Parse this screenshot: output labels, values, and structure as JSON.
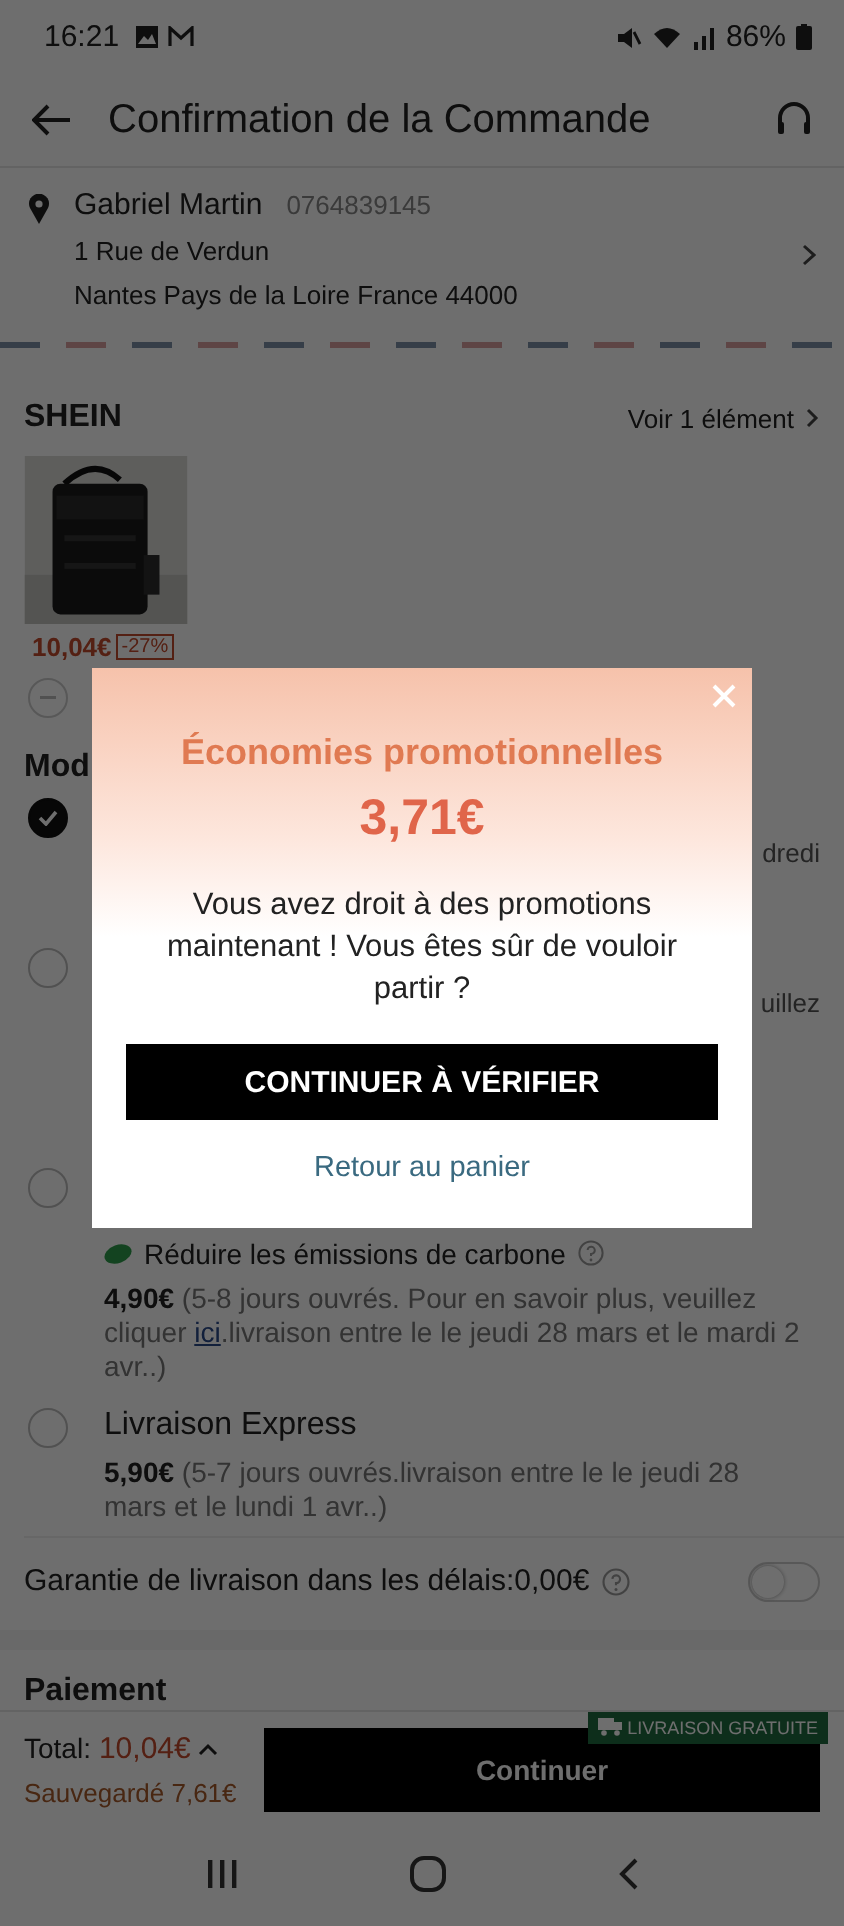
{
  "status_bar": {
    "time": "16:21",
    "battery": "86%"
  },
  "header": {
    "title": "Confirmation de la Commande"
  },
  "address": {
    "name": "Gabriel Martin",
    "phone": "0764839145",
    "line1": "1 Rue de Verdun",
    "line2": "Nantes Pays de la Loire France 44000"
  },
  "store": {
    "name": "SHEIN",
    "link": "Voir 1 élément"
  },
  "product": {
    "kind": "picture",
    "price": "10,04€",
    "discount": "-27%"
  },
  "shipping": {
    "title": "Mod",
    "options": [
      {
        "kind": "fragment",
        "selected": true,
        "fragment": "dredi"
      },
      {
        "kind": "fragment",
        "selected": false,
        "fragment": "uillez"
      },
      {
        "kind": "eco",
        "selected": false,
        "eco": "Réduire les émissions de carbone",
        "price": "4,90€",
        "details_before": "(5-8 jours ouvrés. Pour en savoir plus, veuillez cliquer ",
        "link": "ici",
        "details_after": ".livraison entre le le jeudi 28 mars et le mardi 2 avr..)"
      },
      {
        "kind": "standard",
        "selected": false,
        "name": "Livraison Express",
        "price": "5,90€",
        "details_before": "(5-7 jours ouvrés.livraison entre le le jeudi 28 mars et le lundi 1 avr..)"
      }
    ]
  },
  "guarantee": {
    "label": "Garantie de livraison dans les délais:0,00€",
    "on": false
  },
  "payment": {
    "title": "Paiement"
  },
  "footer": {
    "total_label": "Total:",
    "total": "10,04€",
    "saved": "Sauvegardé 7,61€",
    "button": "Continuer",
    "badge": "LIVRAISON GRATUITE"
  },
  "modal": {
    "title": "Économies promotionnelles",
    "amount": "3,71€",
    "message": "Vous avez droit à des promotions maintenant ! Vous êtes sûr de vouloir partir ?",
    "primary": "CONTINUER À VÉRIFIER",
    "secondary": "Retour au panier"
  }
}
